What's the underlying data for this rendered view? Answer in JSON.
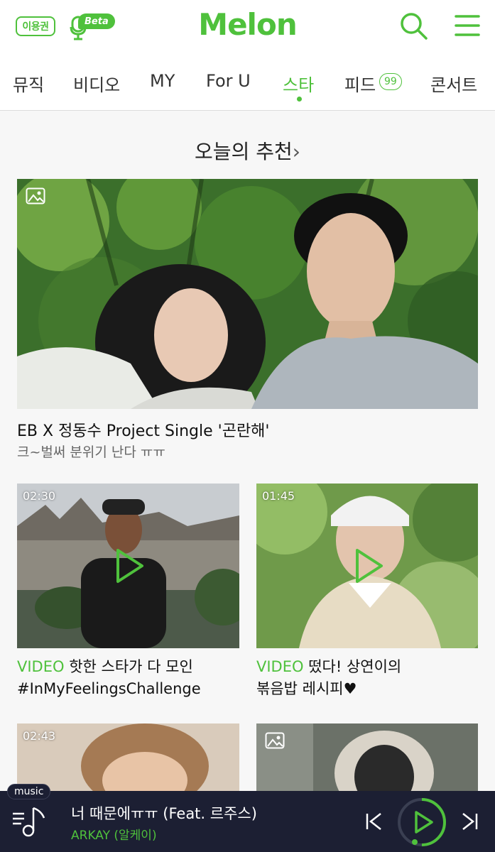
{
  "header": {
    "ticket_label": "이용권",
    "beta_label": "Beta",
    "logo_text": "Melon"
  },
  "tabs": [
    {
      "label": "뮤직"
    },
    {
      "label": "비디오"
    },
    {
      "label": "MY"
    },
    {
      "label": "For U"
    },
    {
      "label": "스타"
    },
    {
      "label": "피드"
    },
    {
      "label": "콘서트"
    }
  ],
  "active_tab": "스타",
  "feed_badge": "99",
  "section": {
    "title": "오늘의 추천",
    "chevron": "›"
  },
  "hero": {
    "title": "EB X 정동수 Project Single '곤란해'",
    "subtitle": "크~벌써 분위기 난다 ㅠㅠ"
  },
  "videos": [
    {
      "duration": "02:30",
      "tag": "VIDEO",
      "line1": "핫한 스타가 다 모인",
      "line2": "#InMyFeelingsChallenge"
    },
    {
      "duration": "01:45",
      "tag": "VIDEO",
      "line1": "떴다! 상연이의",
      "line2": "볶음밥 레시피♥"
    },
    {
      "duration": "02:43"
    }
  ],
  "player": {
    "badge": "music",
    "title": "너 때문에ㅠㅠ (Feat. 르주스)",
    "artist": "ARKAY (알케이)"
  },
  "colors": {
    "brand_green": "#4fc13c",
    "player_bg": "#1c1f33",
    "page_bg": "#f7f7f7"
  }
}
